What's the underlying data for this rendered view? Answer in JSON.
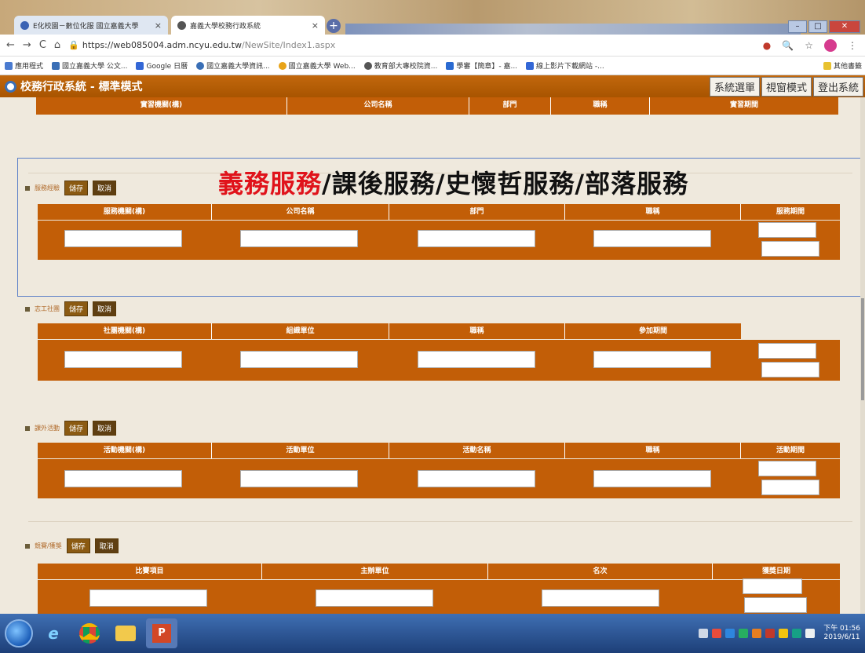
{
  "browser": {
    "tabs": [
      {
        "label": "E化校園－數位化服 國立嘉義大學",
        "active": false
      },
      {
        "label": "嘉義大學校務行政系統",
        "active": true
      }
    ],
    "url_host": "https://web085004.adm.ncyu.edu.tw",
    "url_path": "/NewSite/Index1.aspx",
    "bookmarks": [
      "應用程式",
      "國立嘉義大學 公文...",
      "Google 日曆",
      "國立嘉義大學資訊...",
      "國立嘉義大學 Web...",
      "教育部大專校院資...",
      "學審【簡章】- 嘉...",
      "線上影片下載網站 -...",
      "其他書籤"
    ]
  },
  "app": {
    "title": "校務行政系統 - 標準模式",
    "buttons": [
      "系統選單",
      "視窗模式",
      "登出系統"
    ]
  },
  "overlay_title": {
    "highlight": "義務服務",
    "rest": "/課後服務/史懷哲服務/部落服務"
  },
  "top_header": [
    "實習機關(構)",
    "公司名稱",
    "部門",
    "職稱",
    "實習期間"
  ],
  "sections": [
    {
      "name": "服務經驗",
      "save": "儲存",
      "cancel": "取消",
      "columns": [
        "服務機關(構)",
        "公司名稱",
        "部門",
        "職稱",
        "服務期間"
      ]
    },
    {
      "name": "志工社團",
      "save": "儲存",
      "cancel": "取消",
      "columns": [
        "社團機關(構)",
        "組織單位",
        "職稱",
        "參加期間"
      ]
    },
    {
      "name": "課外活動",
      "save": "儲存",
      "cancel": "取消",
      "columns": [
        "活動機關(構)",
        "活動單位",
        "活動名稱",
        "職稱",
        "活動期間"
      ]
    },
    {
      "name": "競賽/獲獎",
      "save": "儲存",
      "cancel": "取消",
      "columns": [
        "比賽項目",
        "主辦單位",
        "名次",
        "獲獎日期"
      ]
    }
  ],
  "taskbar": {
    "time": "下午 01:56",
    "date": "2019/6/11"
  }
}
